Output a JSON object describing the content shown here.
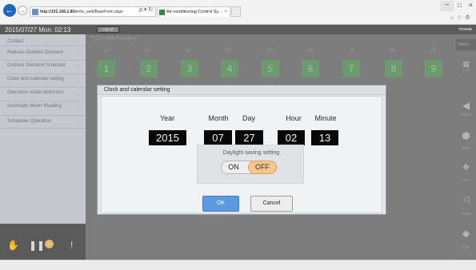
{
  "browser": {
    "url_prefix": "http://192.168.2.80/",
    "url_rest": "emtc_web/BaseForm.aspx",
    "tab_title": "Air-conditioning Control Sy...",
    "tab_close": "×",
    "addr_tools": "ρ ▾ ↻",
    "win_min": "–",
    "win_max": "□",
    "win_close": "×",
    "tool_icons": "⌂ ☆ ⚙"
  },
  "header": {
    "datetime": "2015/07/27  Mon.  02:13",
    "logout": "Log off",
    "brand": "TOSHIB"
  },
  "building_name": "TOSHIBA Building",
  "sidebar": {
    "items": [
      {
        "label": "Contact"
      },
      {
        "label": "Release Outdoor Demand"
      },
      {
        "label": "Outdoor Demand Schedule"
      },
      {
        "label": "Clock and calendar setting"
      },
      {
        "label": "Operation mode restriction"
      },
      {
        "label": "Automatic Meter Reading"
      },
      {
        "label": "Scheduler Operation"
      }
    ],
    "arrow": "..."
  },
  "floors": [
    "1 F",
    "2 F",
    "3 F",
    "4 F",
    "5 F",
    "6 F",
    "7 F",
    "8 F",
    "9 F"
  ],
  "zones": [
    "1",
    "2",
    "3",
    "4",
    "5",
    "6",
    "7",
    "8",
    "9"
  ],
  "right_panel": {
    "select": "Select",
    "num": "1.1F",
    "labels": [
      "Monit",
      "Floo",
      "Time",
      "Area",
      "Unit"
    ]
  },
  "modal": {
    "title": "Clock and calendar setting",
    "fields": [
      {
        "label": "Year",
        "value": "2015"
      },
      {
        "label": "Month",
        "value": "07"
      },
      {
        "label": "Day",
        "value": "27"
      },
      {
        "label": "Hour",
        "value": "02"
      },
      {
        "label": "Minute",
        "value": "13"
      }
    ],
    "dst_label": "Daylight-saving setting",
    "dst_on": "ON",
    "dst_off": "OFF",
    "dst_selected": "OFF",
    "ok_label": "OK",
    "cancel_label": "Cancel"
  },
  "colors": {
    "ok_button": "#5b9ade",
    "dst_selected": "#f8c590",
    "zone_green": "#6a9a6d",
    "value_box": "#070707"
  }
}
